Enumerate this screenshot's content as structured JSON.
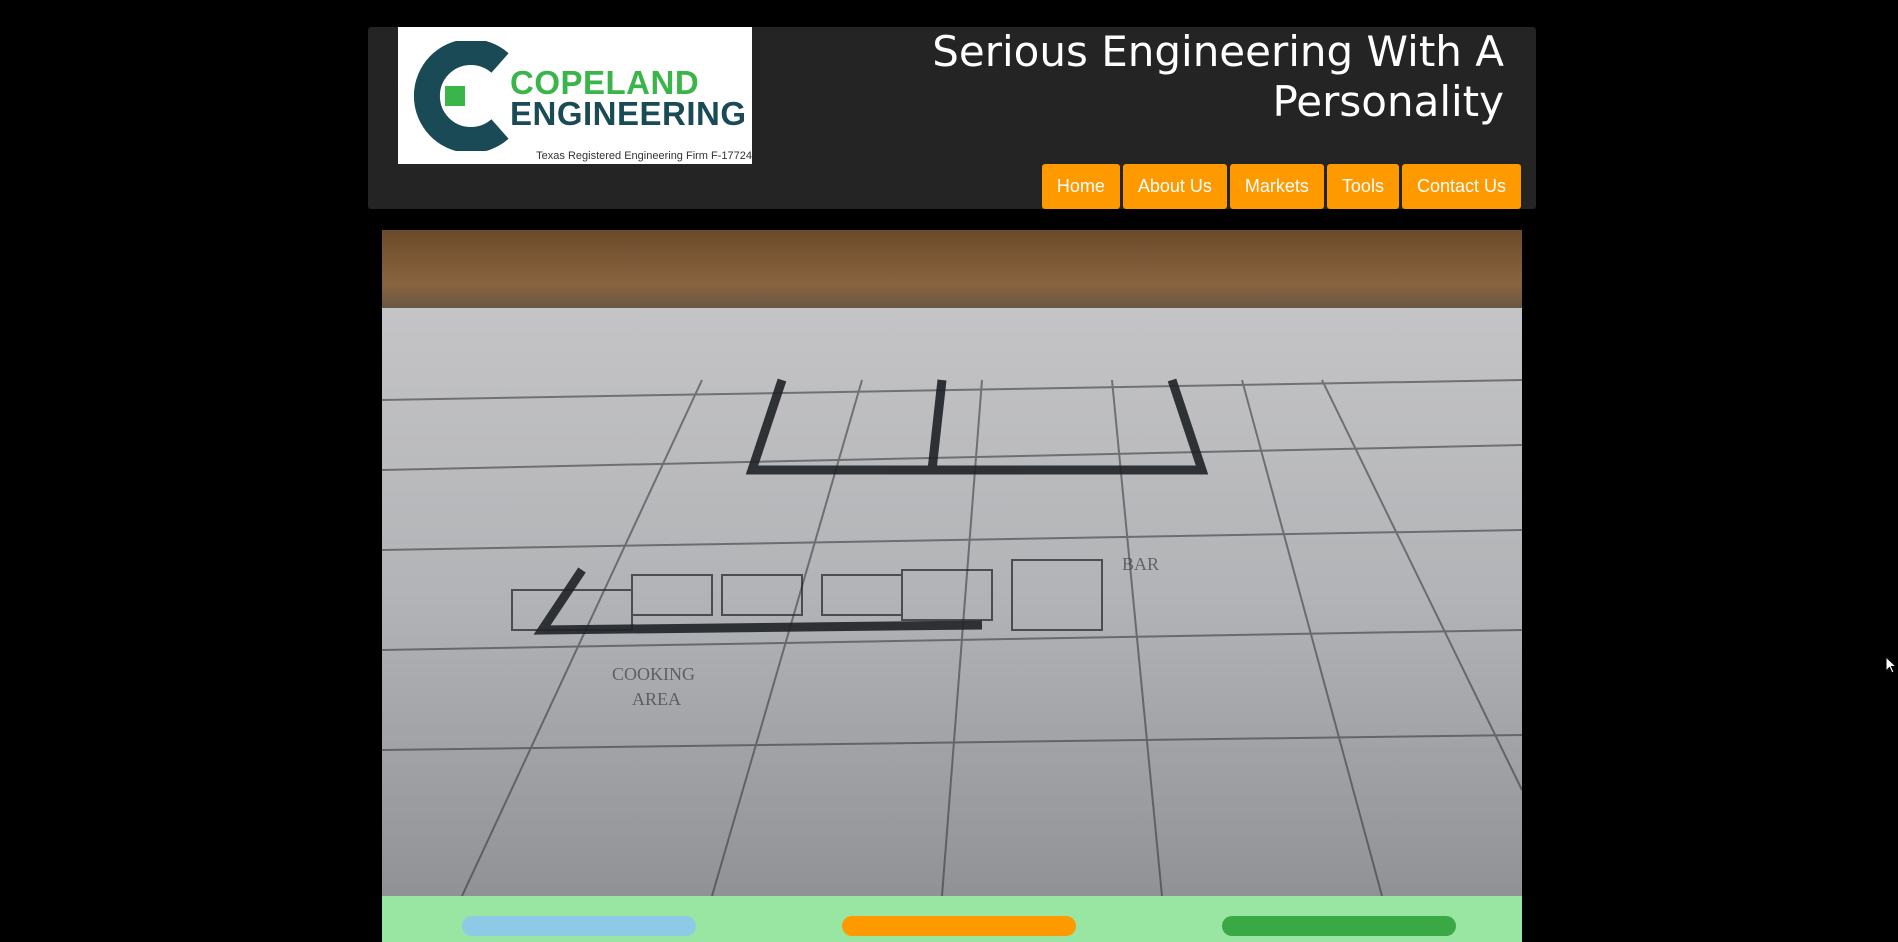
{
  "header": {
    "logo": {
      "line1": "COPELAND",
      "line2": "ENGINEERING",
      "firm_text": "Texas Registered Engineering Firm F-17724"
    },
    "tagline": "Serious Engineering With A Personality",
    "nav": [
      {
        "label": "Home"
      },
      {
        "label": "About Us"
      },
      {
        "label": "Markets"
      },
      {
        "label": "Tools"
      },
      {
        "label": "Contact Us"
      }
    ]
  },
  "colors": {
    "header_bg": "#242424",
    "nav_button": "#ff9900",
    "logo_green": "#39b54a",
    "logo_navy": "#1a4a55",
    "band": "#98e6a1",
    "pill_blue": "#8ecae6",
    "pill_orange": "#ff9900",
    "pill_green": "#3aa845"
  },
  "hero": {
    "image": "blueprint-floorplan-photo"
  },
  "buttons": [
    {
      "color": "#8ecae6"
    },
    {
      "color": "#ff9900"
    },
    {
      "color": "#3aa845"
    }
  ]
}
